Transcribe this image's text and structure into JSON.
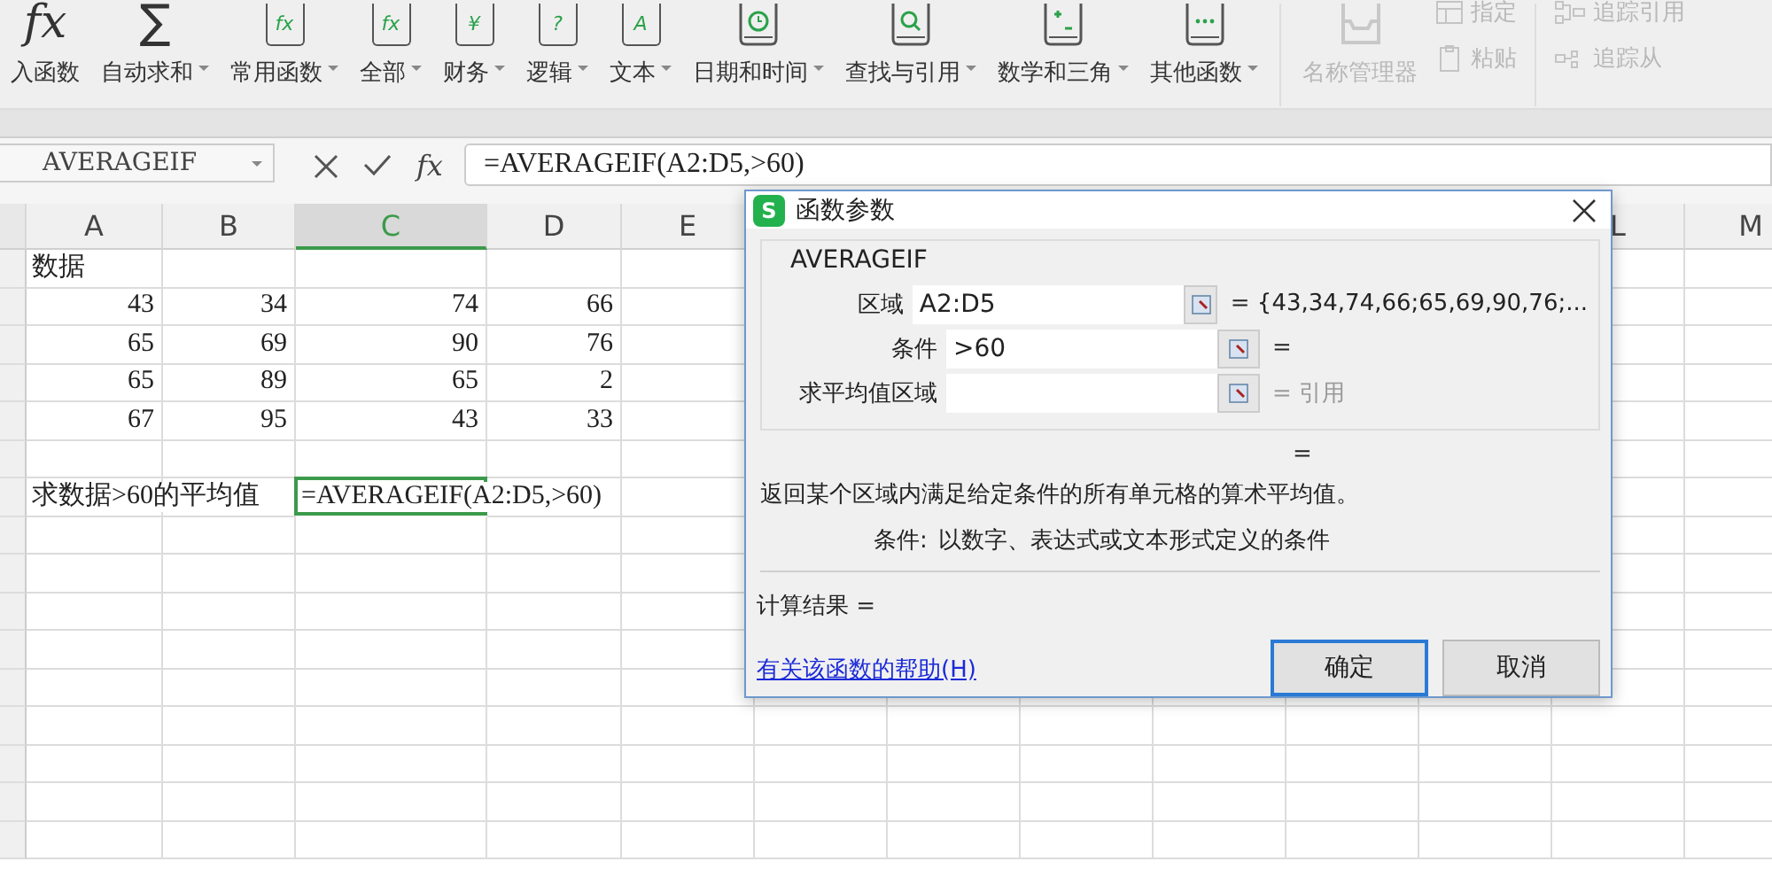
{
  "ribbon": {
    "items": [
      {
        "kind": "glyph",
        "glyph": "fx",
        "label": "入函数",
        "dropdown": false,
        "disabled": false
      },
      {
        "kind": "glyph",
        "glyph": "∑",
        "label": "自动求和",
        "dropdown": true,
        "disabled": false
      },
      {
        "kind": "book",
        "glyph": "fx",
        "label": "常用函数",
        "dropdown": true,
        "disabled": false
      },
      {
        "kind": "book",
        "glyph": "fx",
        "label": "全部",
        "dropdown": true,
        "disabled": false
      },
      {
        "kind": "book",
        "glyph": "¥",
        "label": "财务",
        "dropdown": true,
        "disabled": false
      },
      {
        "kind": "book",
        "glyph": "?",
        "label": "逻辑",
        "dropdown": true,
        "disabled": false
      },
      {
        "kind": "book",
        "glyph": "A",
        "label": "文本",
        "dropdown": true,
        "disabled": false
      },
      {
        "kind": "clock",
        "label": "日期和时间",
        "dropdown": true,
        "disabled": false
      },
      {
        "kind": "search",
        "label": "查找与引用",
        "dropdown": true,
        "disabled": false
      },
      {
        "kind": "math",
        "label": "数学和三角",
        "dropdown": true,
        "disabled": false
      },
      {
        "kind": "more",
        "label": "其他函数",
        "dropdown": true,
        "disabled": false
      },
      {
        "kind": "manager",
        "label": "名称管理器",
        "dropdown": false,
        "disabled": true
      }
    ],
    "small_items": [
      {
        "kind": "table",
        "label": "指定",
        "disabled": true
      },
      {
        "kind": "paste",
        "label": "粘贴",
        "disabled": true
      },
      {
        "kind": "trace",
        "label": "追踪引用",
        "disabled": true
      },
      {
        "kind": "trace2",
        "label": "追踪从",
        "disabled": true
      }
    ]
  },
  "formula_bar": {
    "name_box": "AVERAGEIF",
    "fx": "fx",
    "formula": "=AVERAGEIF(A2:D5,>60)"
  },
  "sheet": {
    "columns": [
      {
        "label": "A",
        "selected": false
      },
      {
        "label": "B",
        "selected": false
      },
      {
        "label": "C",
        "selected": true
      },
      {
        "label": "D",
        "selected": false
      },
      {
        "label": "E",
        "selected": false
      },
      {
        "label": "L",
        "selected": false
      },
      {
        "label": "M",
        "selected": false
      }
    ],
    "rows": [
      {
        "kind": "text",
        "cells": [
          {
            "text": "数据",
            "selected": false
          }
        ]
      },
      {
        "kind": "number",
        "cells": [
          {
            "text": "43",
            "selected": false
          },
          {
            "text": "34",
            "selected": false
          },
          {
            "text": "74",
            "selected": false
          },
          {
            "text": "66",
            "selected": false
          }
        ]
      },
      {
        "kind": "number",
        "cells": [
          {
            "text": "65",
            "selected": false
          },
          {
            "text": "69",
            "selected": false
          },
          {
            "text": "90",
            "selected": false
          },
          {
            "text": "76",
            "selected": false
          }
        ]
      },
      {
        "kind": "number",
        "cells": [
          {
            "text": "65",
            "selected": false
          },
          {
            "text": "89",
            "selected": false
          },
          {
            "text": "65",
            "selected": false
          },
          {
            "text": "2",
            "selected": false
          }
        ]
      },
      {
        "kind": "number",
        "cells": [
          {
            "text": "67",
            "selected": false
          },
          {
            "text": "95",
            "selected": false
          },
          {
            "text": "43",
            "selected": false
          },
          {
            "text": "33",
            "selected": false
          }
        ]
      },
      {
        "kind": "empty"
      },
      {
        "kind": "text",
        "cells": [
          {
            "text": "求数据>60的平均值",
            "selected": false
          },
          null,
          {
            "text": "=AVERAGEIF(A2:D5,>60)",
            "selected": true
          }
        ]
      }
    ]
  },
  "dialog": {
    "logo": "S",
    "title": "函数参数",
    "function": "AVERAGEIF",
    "params": [
      {
        "label": "区域",
        "value": "A2:D5",
        "result": "= {43,34,74,66;65,69,90,76;...",
        "dim": false
      },
      {
        "label": "条件",
        "value": ">60",
        "result": "=",
        "dim": false
      },
      {
        "label": "求平均值区域",
        "result": "= 引用",
        "dim": true
      }
    ],
    "total": "=",
    "description": "返回某个区域内满足给定条件的所有单元格的算术平均值。",
    "arg_name": "条件:",
    "arg_help": "以数字、表达式或文本形式定义的条件",
    "result": "计算结果 =",
    "help_link": "有关该函数的帮助(H)",
    "buttons": [
      {
        "label": "确定",
        "default": true
      },
      {
        "label": "取消",
        "default": false
      }
    ]
  }
}
